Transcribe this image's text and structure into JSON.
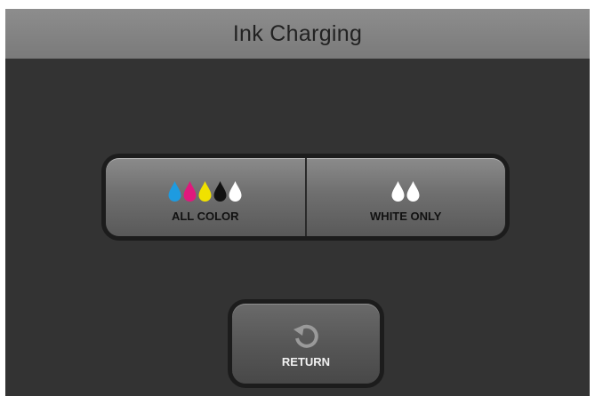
{
  "title": "Ink Charging",
  "buttons": {
    "all_color": {
      "label": "ALL COLOR",
      "drops": [
        "#1e9be0",
        "#e0187d",
        "#f0e100",
        "#111111",
        "#ffffff"
      ]
    },
    "white_only": {
      "label": "WHITE ONLY",
      "drops": [
        "#ffffff",
        "#ffffff"
      ]
    },
    "return": {
      "label": "RETURN",
      "icon": "return-icon"
    }
  },
  "colors": {
    "background": "#333333",
    "title_bar": "#858585"
  }
}
